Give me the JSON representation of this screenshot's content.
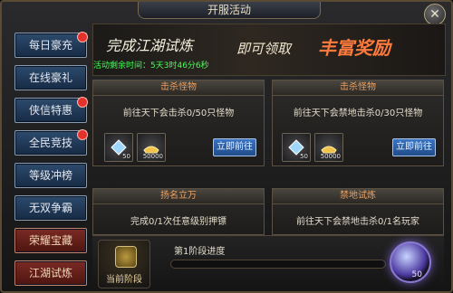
{
  "window": {
    "title": "开服活动",
    "close_glyph": "✕"
  },
  "sidebar": {
    "items": [
      {
        "label": "每日豪充",
        "badge": true,
        "style": "blue"
      },
      {
        "label": "在线豪礼",
        "badge": false,
        "style": "blue"
      },
      {
        "label": "侠信特惠",
        "badge": true,
        "style": "blue"
      },
      {
        "label": "全民竞技",
        "badge": true,
        "style": "blue"
      },
      {
        "label": "等级冲榜",
        "badge": false,
        "style": "blue"
      },
      {
        "label": "无双争霸",
        "badge": false,
        "style": "blue"
      },
      {
        "label": "荣耀宝藏",
        "badge": false,
        "style": "red"
      },
      {
        "label": "江湖试炼",
        "badge": false,
        "style": "red"
      }
    ]
  },
  "banner": {
    "line1": "完成江湖试炼",
    "line2": "即可领取",
    "line3": "丰富奖励",
    "timer_label": "活动剩余时间：",
    "timer_value": "5天3时46分6秒"
  },
  "cards": [
    {
      "header": "击杀怪物",
      "desc": "前往天下会击杀0/50只怪物",
      "rewards": [
        {
          "icon": "crystal-icon",
          "count": "50"
        },
        {
          "icon": "gold-ingot-icon",
          "count": "50000"
        }
      ],
      "button": "立即前往"
    },
    {
      "header": "击杀怪物",
      "desc": "前往天下会禁地击杀0/30只怪物",
      "rewards": [
        {
          "icon": "crystal-icon",
          "count": "50"
        },
        {
          "icon": "gold-ingot-icon",
          "count": "50000"
        }
      ],
      "button": "立即前往"
    },
    {
      "header": "扬名立万",
      "desc": "完成0/1次任意级别押镖"
    },
    {
      "header": "禁地试炼",
      "desc": "前往天下会禁地击杀0/1名玩家"
    }
  ],
  "bottom": {
    "stage_label": "当前阶段",
    "progress_title": "第1阶段进度",
    "progress_fraction": 0,
    "reward_count": "50"
  }
}
